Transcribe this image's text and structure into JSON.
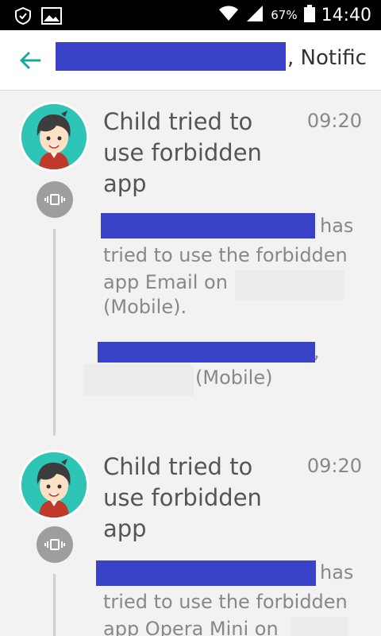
{
  "statusbar": {
    "battery_percent": "67%",
    "time": "14:40"
  },
  "toolbar": {
    "title_suffix": ", Notific"
  },
  "notifications": [
    {
      "title": "Child tried to use forbidden app",
      "time": "09:20",
      "text_after_name": "has",
      "body": "tried to use the forbidden app Email on",
      "device_suffix": "(Mobile).",
      "sender_suffix": ",",
      "sender_device": "(Mobile)"
    },
    {
      "title": "Child tried to use forbidden app",
      "time": "09:20",
      "text_after_name": "has",
      "body": "tried to use the forbidden app Opera Mini on"
    }
  ]
}
